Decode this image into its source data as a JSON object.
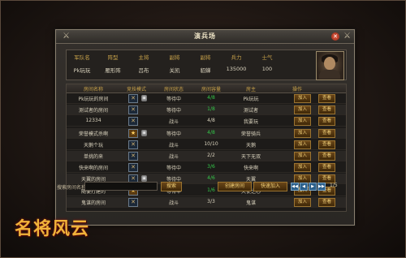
{
  "window": {
    "title": "演兵场"
  },
  "player": {
    "headers": [
      "军队名",
      "阵型",
      "主将",
      "副将",
      "副将",
      "兵力",
      "士气"
    ],
    "values": [
      "Pk玩玩",
      "雁形阵",
      "吕布",
      "关凯",
      "貂蝉",
      "135000",
      "100"
    ]
  },
  "table": {
    "columns": [
      "房间名称",
      "竞技模式",
      "房间状态",
      "房间容量",
      "房主",
      "操作"
    ],
    "rows": [
      {
        "name": "Pk玩玩的房间",
        "mode": "cross",
        "locked": true,
        "status": "等待中",
        "capacity": "4/8",
        "cap_color": "green",
        "owner": "Pk玩玩",
        "join": "加入",
        "view": "查看"
      },
      {
        "name": "测试者的房间",
        "mode": "cross",
        "locked": false,
        "status": "等待中",
        "capacity": "1/8",
        "cap_color": "green",
        "owner": "测试者",
        "join": "加入",
        "view": "查看"
      },
      {
        "name": "12334",
        "mode": "cross",
        "locked": false,
        "status": "战斗",
        "capacity": "4/8",
        "cap_color": "white",
        "owner": "我要玩",
        "join": "加入",
        "view": "查看"
      },
      {
        "name": "荣誉模式杀啊",
        "mode": "special",
        "locked": true,
        "status": "等待中",
        "capacity": "4/8",
        "cap_color": "green",
        "owner": "荣誉骑兵",
        "join": "加入",
        "view": "查看"
      },
      {
        "name": "天鹅个玩",
        "mode": "cross",
        "locked": false,
        "status": "战斗",
        "capacity": "10/10",
        "cap_color": "white",
        "owner": "天鹅",
        "join": "加入",
        "view": "查看"
      },
      {
        "name": "单挑的来",
        "mode": "cross",
        "locked": false,
        "status": "战斗",
        "capacity": "2/2",
        "cap_color": "white",
        "owner": "天下无双",
        "join": "加入",
        "view": "查看"
      },
      {
        "name": "快来啊的房间",
        "mode": "cross",
        "locked": false,
        "status": "等待中",
        "capacity": "3/6",
        "cap_color": "green",
        "owner": "快来啊",
        "join": "加入",
        "view": "查看"
      },
      {
        "name": "天翼的房间",
        "mode": "cross",
        "locked": true,
        "status": "等待中",
        "capacity": "4/6",
        "cap_color": "green",
        "owner": "天翼",
        "join": "加入",
        "view": "查看"
      },
      {
        "name": "随便打建的",
        "mode": "special",
        "locked": false,
        "status": "等待中",
        "capacity": "1/6",
        "cap_color": "green",
        "owner": "天使之心",
        "join": "加入",
        "view": "查看"
      },
      {
        "name": "鬼谋的房间",
        "mode": "cross",
        "locked": false,
        "status": "战斗",
        "capacity": "3/3",
        "cap_color": "white",
        "owner": "鬼谋",
        "join": "加入",
        "view": "查看"
      }
    ]
  },
  "footer": {
    "search_label": "搜索房间名称",
    "search_button": "搜索",
    "create_button": "创建房间",
    "quick_join_button": "快速加入",
    "page": "1/5"
  },
  "logo_text": "名将风云"
}
